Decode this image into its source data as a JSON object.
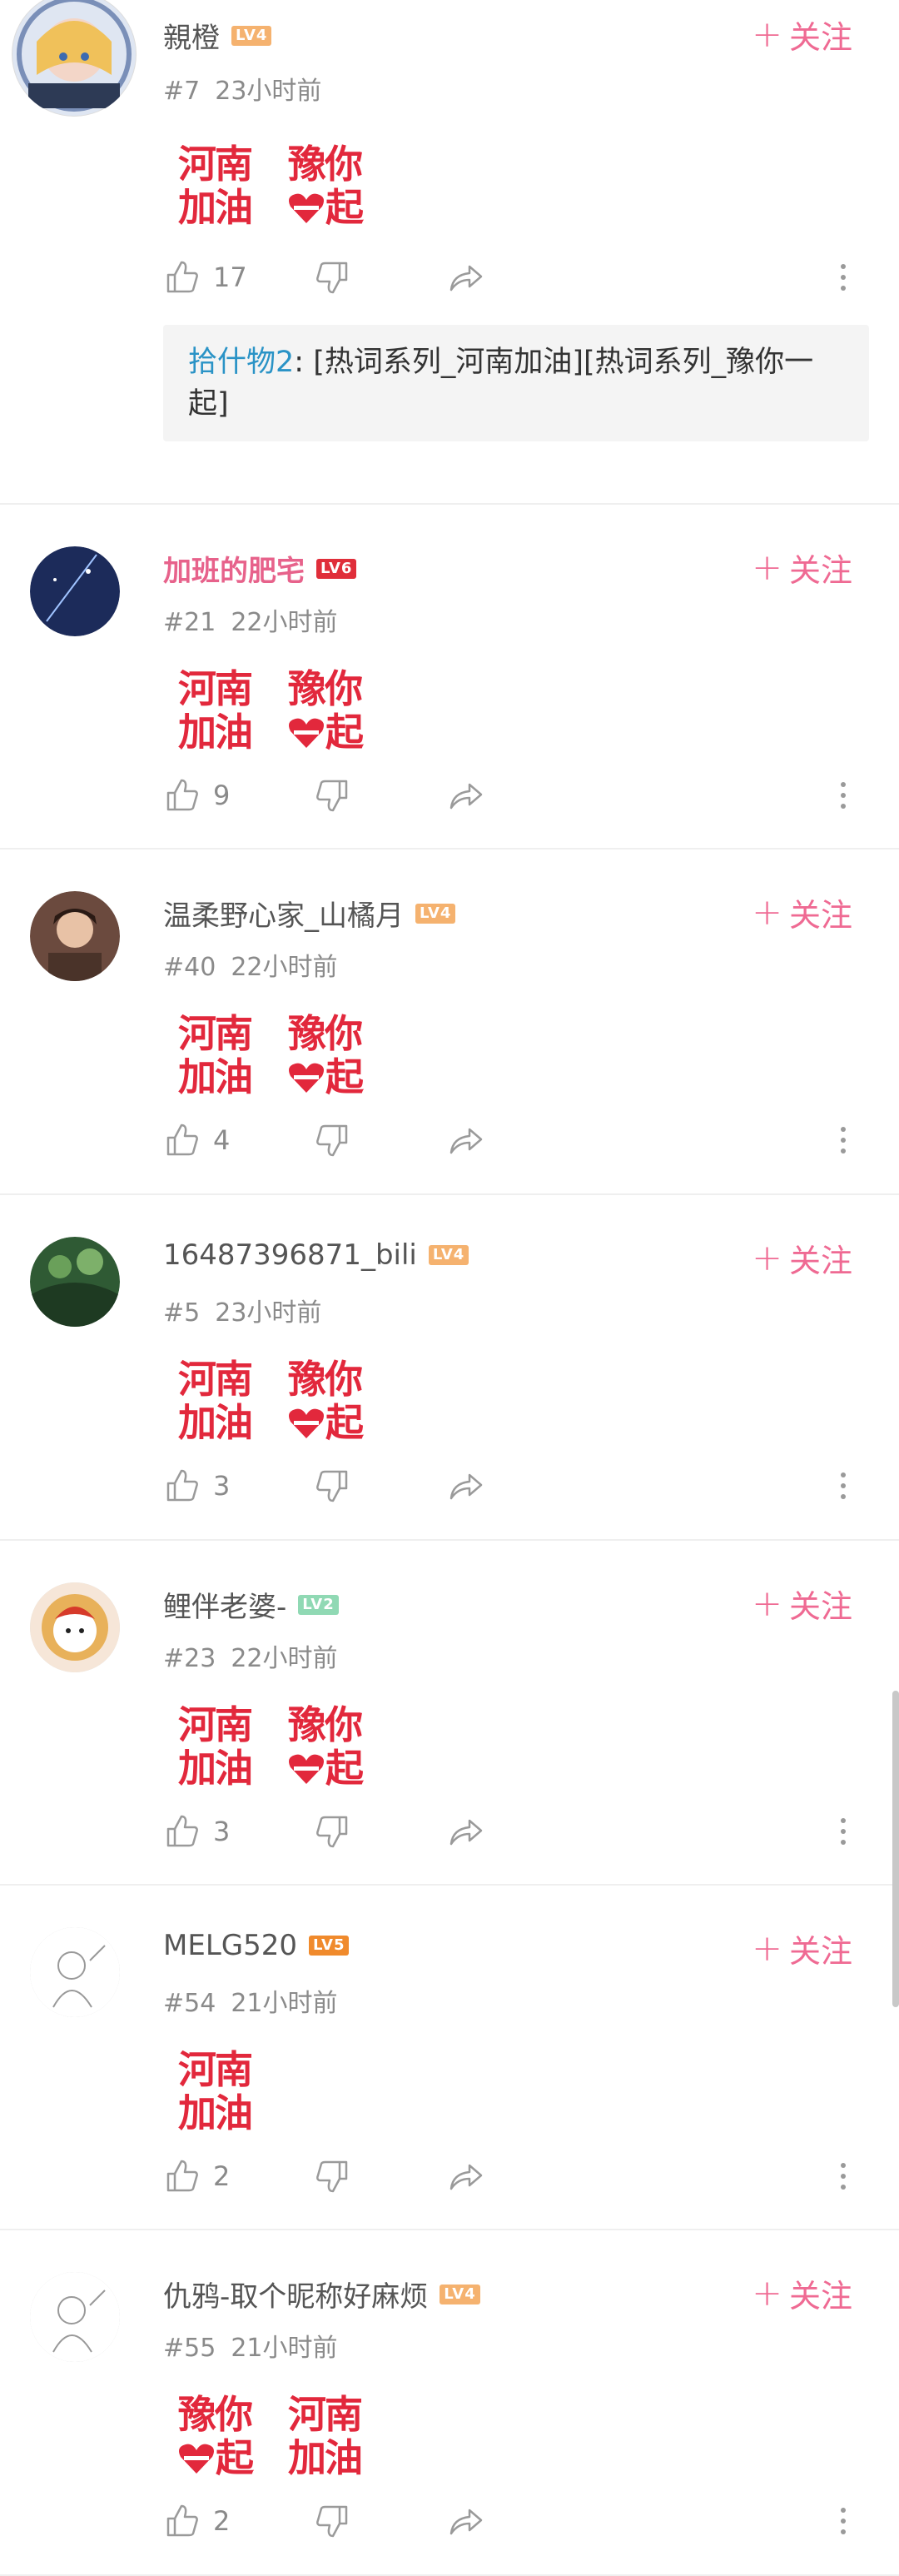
{
  "comments": [
    {
      "user": "親橙",
      "level": "LV4",
      "floor": "#7",
      "time": "23小时前",
      "stickers": [
        "henan",
        "yuni"
      ],
      "likes": "17",
      "reply": {
        "user": "拾什物2",
        "text": ": [热词系列_河南加油][热词系列_豫你一起]"
      }
    },
    {
      "user": "加班的肥宅",
      "level": "LV6",
      "floor": "#21",
      "time": "22小时前",
      "stickers": [
        "henan",
        "yuni"
      ],
      "likes": "9"
    },
    {
      "user": "温柔野心家_山橘月",
      "level": "LV4",
      "floor": "#40",
      "time": "22小时前",
      "stickers": [
        "henan",
        "yuni"
      ],
      "likes": "4"
    },
    {
      "user": "16487396871_bili",
      "level": "LV4",
      "floor": "#5",
      "time": "23小时前",
      "stickers": [
        "henan",
        "yuni"
      ],
      "likes": "3"
    },
    {
      "user": "鲤伴老婆-",
      "level": "LV2",
      "floor": "#23",
      "time": "22小时前",
      "stickers": [
        "henan",
        "yuni"
      ],
      "likes": "3"
    },
    {
      "user": "MELG520",
      "level": "LV5",
      "floor": "#54",
      "time": "21小时前",
      "stickers": [
        "henan"
      ],
      "likes": "2"
    },
    {
      "user": "仇鸦-取个昵称好麻烦",
      "level": "LV4",
      "floor": "#55",
      "time": "21小时前",
      "stickers": [
        "yuni",
        "henan"
      ],
      "likes": "2"
    }
  ],
  "follow_label": "关注",
  "sticker_text": {
    "henan_top": "河南",
    "henan_bottom": "加油",
    "yuni_top": "豫你",
    "yuni_bottom": "起"
  },
  "colors": {
    "accent": "#ef6a93",
    "sticker": "#e2283c",
    "reply_user": "#2a93c6"
  }
}
